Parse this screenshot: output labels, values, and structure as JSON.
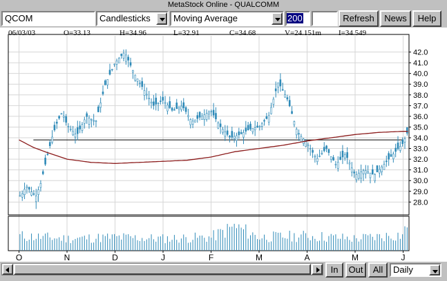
{
  "window": {
    "title": "MetaStock Online - QUALCOMM"
  },
  "toolbar": {
    "symbol": "QCOM",
    "chart_style": "Candlesticks",
    "indicator": "Moving Average",
    "period": "200",
    "extra_field": "",
    "refresh_label": "Refresh",
    "news_label": "News",
    "help_label": "Help"
  },
  "quote": {
    "date": "06/03/03",
    "open": "O=33.13",
    "high": "H=34.96",
    "low": "L=32.91",
    "close": "C=34.68",
    "volume": "V=24.151m",
    "open_interest": "I=34.549"
  },
  "bottom": {
    "zoom_in_label": "In",
    "zoom_out_label": "Out",
    "all_label": "All",
    "interval": "Daily"
  },
  "colors": {
    "candle": "#2e8ab8",
    "moving_average": "#8b1a1a",
    "trend_line": "#000000",
    "volume": "#2e8ab8",
    "grid": "#d6d6d6"
  },
  "chart_data": {
    "type": "candlestick",
    "title": "",
    "symbol": "QCOM",
    "ylim": [
      26.8,
      43.0
    ],
    "y_ticks": [
      28.0,
      29.0,
      30.0,
      31.0,
      32.0,
      33.0,
      34.0,
      35.0,
      36.0,
      37.0,
      38.0,
      39.0,
      40.0,
      41.0,
      42.0
    ],
    "x_tick_labels": [
      "O",
      "N",
      "D",
      "J",
      "F",
      "M",
      "A",
      "M",
      "J"
    ],
    "grid": true,
    "trend_line_level": 33.8,
    "series": [
      {
        "name": "",
        "kind": "close_path",
        "x_month": [
          0.05,
          0.15,
          0.25,
          0.35,
          0.45,
          0.6,
          0.7,
          0.8,
          0.9,
          1.0,
          1.2,
          1.4,
          1.6,
          1.8,
          2.0,
          2.2,
          2.4,
          2.6,
          2.8,
          3.0,
          3.2,
          3.4,
          3.6,
          3.8,
          4.0,
          4.2,
          4.4,
          4.6,
          4.8,
          5.0,
          5.2,
          5.4,
          5.6,
          5.8,
          6.0,
          6.2,
          6.4,
          6.6,
          6.8,
          7.0,
          7.2,
          7.4,
          7.6,
          7.8,
          8.0,
          8.1
        ],
        "close": [
          28.6,
          29.5,
          29.0,
          28.5,
          29.7,
          32.5,
          34.2,
          35.5,
          36.4,
          35.2,
          34.2,
          36.0,
          35.5,
          39.0,
          41.0,
          42.0,
          40.0,
          38.5,
          37.0,
          37.5,
          36.5,
          37.0,
          35.5,
          36.0,
          36.5,
          35.0,
          34.0,
          34.3,
          34.8,
          35.0,
          36.0,
          39.2,
          37.5,
          34.5,
          33.5,
          32.0,
          33.0,
          31.5,
          32.5,
          30.5,
          31.0,
          30.5,
          31.5,
          32.5,
          33.5,
          34.6
        ]
      },
      {
        "name": "",
        "kind": "moving_average",
        "x_month": [
          0.0,
          0.3,
          0.6,
          1.0,
          1.5,
          2.0,
          2.5,
          3.0,
          3.5,
          4.0,
          4.5,
          5.0,
          5.5,
          6.0,
          6.5,
          7.0,
          7.5,
          8.0,
          8.1
        ],
        "values": [
          33.8,
          33.1,
          32.6,
          32.0,
          31.7,
          31.6,
          31.7,
          31.8,
          31.9,
          32.2,
          32.7,
          33.0,
          33.3,
          33.7,
          34.0,
          34.3,
          34.5,
          34.6,
          34.6
        ]
      }
    ],
    "volume": {
      "x_month": [
        0.0,
        1.0,
        2.0,
        3.0,
        4.0,
        4.5,
        5.0,
        6.0,
        7.0,
        8.0,
        8.1
      ],
      "relative": [
        0.55,
        0.45,
        0.5,
        0.45,
        0.5,
        0.9,
        0.5,
        0.55,
        0.45,
        0.6,
        1.0
      ]
    }
  }
}
